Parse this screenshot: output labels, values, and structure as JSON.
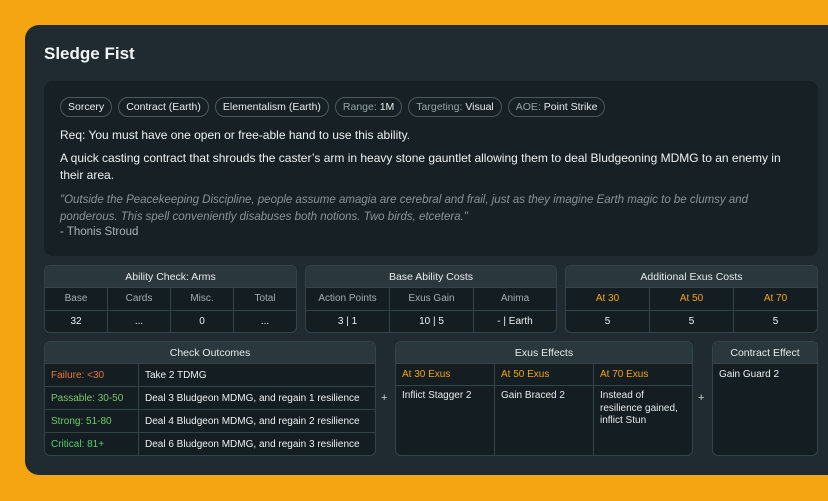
{
  "title": "Sledge Fist",
  "tags": [
    {
      "value": "Sorcery"
    },
    {
      "value": "Contract (Earth)"
    },
    {
      "value": "Elementalism (Earth)"
    },
    {
      "key": "Range:",
      "value": "1M"
    },
    {
      "key": "Targeting:",
      "value": "Visual"
    },
    {
      "key": "AOE:",
      "value": "Point Strike"
    }
  ],
  "requirement": "Req: You must have one open or free-able hand to use this ability.",
  "description": "A quick casting contract that shrouds the caster’s arm in heavy stone gauntlet allowing them to deal Bludgeoning MDMG to an enemy in their area.",
  "quote": "\"Outside the Peacekeeping Discipline, people assume amagia are cerebral and frail, just as they imagine Earth magic to be clumsy and ponderous. This spell conveniently disabuses both notions. Two birds, etcetera.\"",
  "quote_author": "- Thonis Stroud",
  "ability_check": {
    "title": "Ability Check: Arms",
    "headers": [
      "Base",
      "Cards",
      "Misc.",
      "Total"
    ],
    "values": [
      "32",
      "...",
      "0",
      "..."
    ]
  },
  "base_costs": {
    "title": "Base Ability Costs",
    "headers": [
      "Action Points",
      "Exus Gain",
      "Anima"
    ],
    "values": [
      "3 | 1",
      "10 | 5",
      "- | Earth"
    ]
  },
  "additional_costs": {
    "title": "Additional Exus Costs",
    "headers": [
      "At 30",
      "At 50",
      "At 70"
    ],
    "values": [
      "5",
      "5",
      "5"
    ]
  },
  "check_outcomes": {
    "title": "Check Outcomes",
    "rows": [
      {
        "label": "Failure: <30",
        "value": "Take 2 TDMG",
        "color": "#e8763a"
      },
      {
        "label": "Passable: 30-50",
        "value": "Deal 3 Bludgeon MDMG, and regain 1 resilience",
        "color": "#7bc86a"
      },
      {
        "label": "Strong: 51-80",
        "value": "Deal 4 Bludgeon MDMG, and regain 2 resilience",
        "color": "#6fcf68"
      },
      {
        "label": "Critical: 81+",
        "value": "Deal 6 Bludgeon MDMG, and regain 3 resilience",
        "color": "#56d06a"
      }
    ]
  },
  "plus_sign": "+",
  "exus_effects": {
    "title": "Exus Effects",
    "headers": [
      "At 30 Exus",
      "At 50 Exus",
      "At 70 Exus"
    ],
    "values": [
      "Inflict Stagger 2",
      "Gain Braced 2",
      "Instead of resilience gained, inflict Stun"
    ]
  },
  "contract_effect": {
    "title": "Contract Effect",
    "value": "Gain Guard 2"
  },
  "accent_color": "#f5a511"
}
